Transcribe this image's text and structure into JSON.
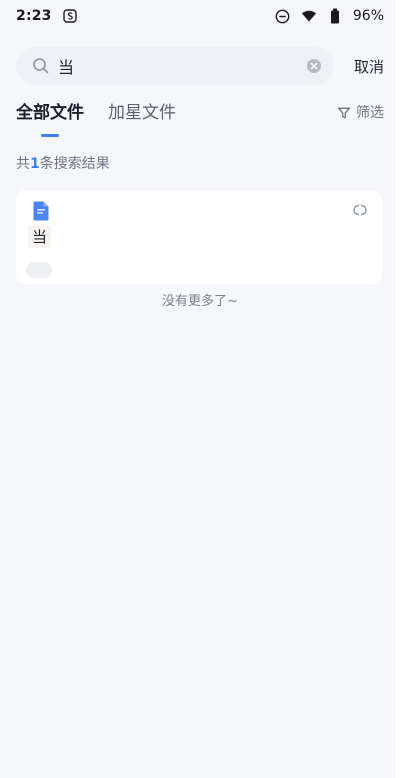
{
  "status_bar": {
    "time": "2:23",
    "battery": "96%",
    "icons": [
      "notification-s-icon",
      "do-not-disturb-icon",
      "wifi-icon",
      "battery-icon"
    ]
  },
  "search": {
    "query": "当",
    "placeholder": "",
    "cancel_label": "取消",
    "icons": [
      "search-icon",
      "clear-icon"
    ]
  },
  "tabs": [
    {
      "label": "全部文件",
      "active": true
    },
    {
      "label": "加星文件",
      "active": false
    }
  ],
  "filter": {
    "label": "筛选",
    "icon": "filter-icon"
  },
  "results": {
    "prefix": "共",
    "count": "1",
    "suffix": "条搜索结果",
    "items": [
      {
        "snippet": "当",
        "doc_icon": "doc-icon",
        "more_icon": "more-icon",
        "meta": ""
      }
    ],
    "end_text": "没有更多了~"
  },
  "colors": {
    "background": "#f5f7fb",
    "accent": "#3d7ef4",
    "card": "#ffffff",
    "muted_text": "#6e7484"
  }
}
